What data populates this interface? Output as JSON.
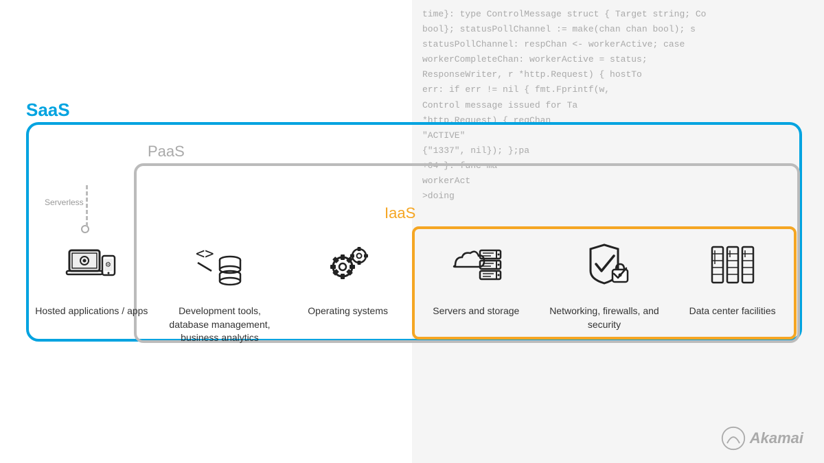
{
  "labels": {
    "saas": "SaaS",
    "paas": "PaaS",
    "iaas": "IaaS",
    "serverless": "Serverless"
  },
  "columns": [
    {
      "id": "hosted-apps",
      "label": "Hosted applications / apps",
      "icon": "laptop-phone"
    },
    {
      "id": "dev-tools",
      "label": "Development tools, database management, business analytics",
      "icon": "database-code"
    },
    {
      "id": "operating-systems",
      "label": "Operating systems",
      "icon": "gear"
    },
    {
      "id": "servers-storage",
      "label": "Servers and storage",
      "icon": "server-stack"
    },
    {
      "id": "networking",
      "label": "Networking, firewalls, and security",
      "icon": "shield-check"
    },
    {
      "id": "data-center",
      "label": "Data center facilities",
      "icon": "data-center"
    }
  ],
  "code_lines": [
    "time}: type ControlMessage struct { Target string; Co",
    "bool}; statusPollChannel := make(chan chan bool); s",
    "statusPollChannel: respChan <- workerActive; case",
    "     workerCompleteChan: workerActive = status;",
    "     ResponseWriter, r *http.Request) { hostTo",
    "          err: if err != nil { fmt.Fprintf(w,",
    "               Control message issued for Ta",
    "               *http.Request) { reqChan",
    "                    \"ACTIVE\"",
    "     {\"1337\", nil}); };pa",
    "     +04 }: func ma",
    "          workerAct",
    "               >doing"
  ],
  "akamai": {
    "text": "Akamai"
  }
}
